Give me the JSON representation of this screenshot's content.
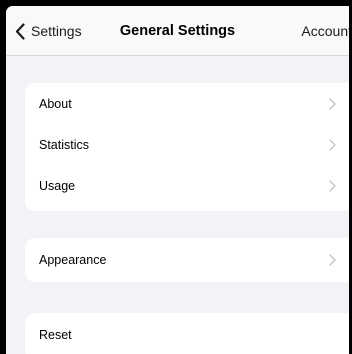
{
  "nav": {
    "back_label": "Settings",
    "title": "General Settings",
    "right_label": "Account"
  },
  "groups": [
    {
      "items": [
        {
          "label": "About",
          "icon": "chevron-right-icon"
        },
        {
          "label": "Statistics",
          "icon": "chevron-right-icon"
        },
        {
          "label": "Usage",
          "icon": "chevron-right-icon"
        }
      ]
    },
    {
      "items": [
        {
          "label": "Appearance",
          "icon": "chevron-right-icon"
        }
      ]
    },
    {
      "items": [
        {
          "label": "Reset"
        }
      ]
    }
  ],
  "colors": {
    "background": "#f2f2f7",
    "cell": "#ffffff",
    "chevron": "#c4c4c7",
    "text": "#000000"
  }
}
